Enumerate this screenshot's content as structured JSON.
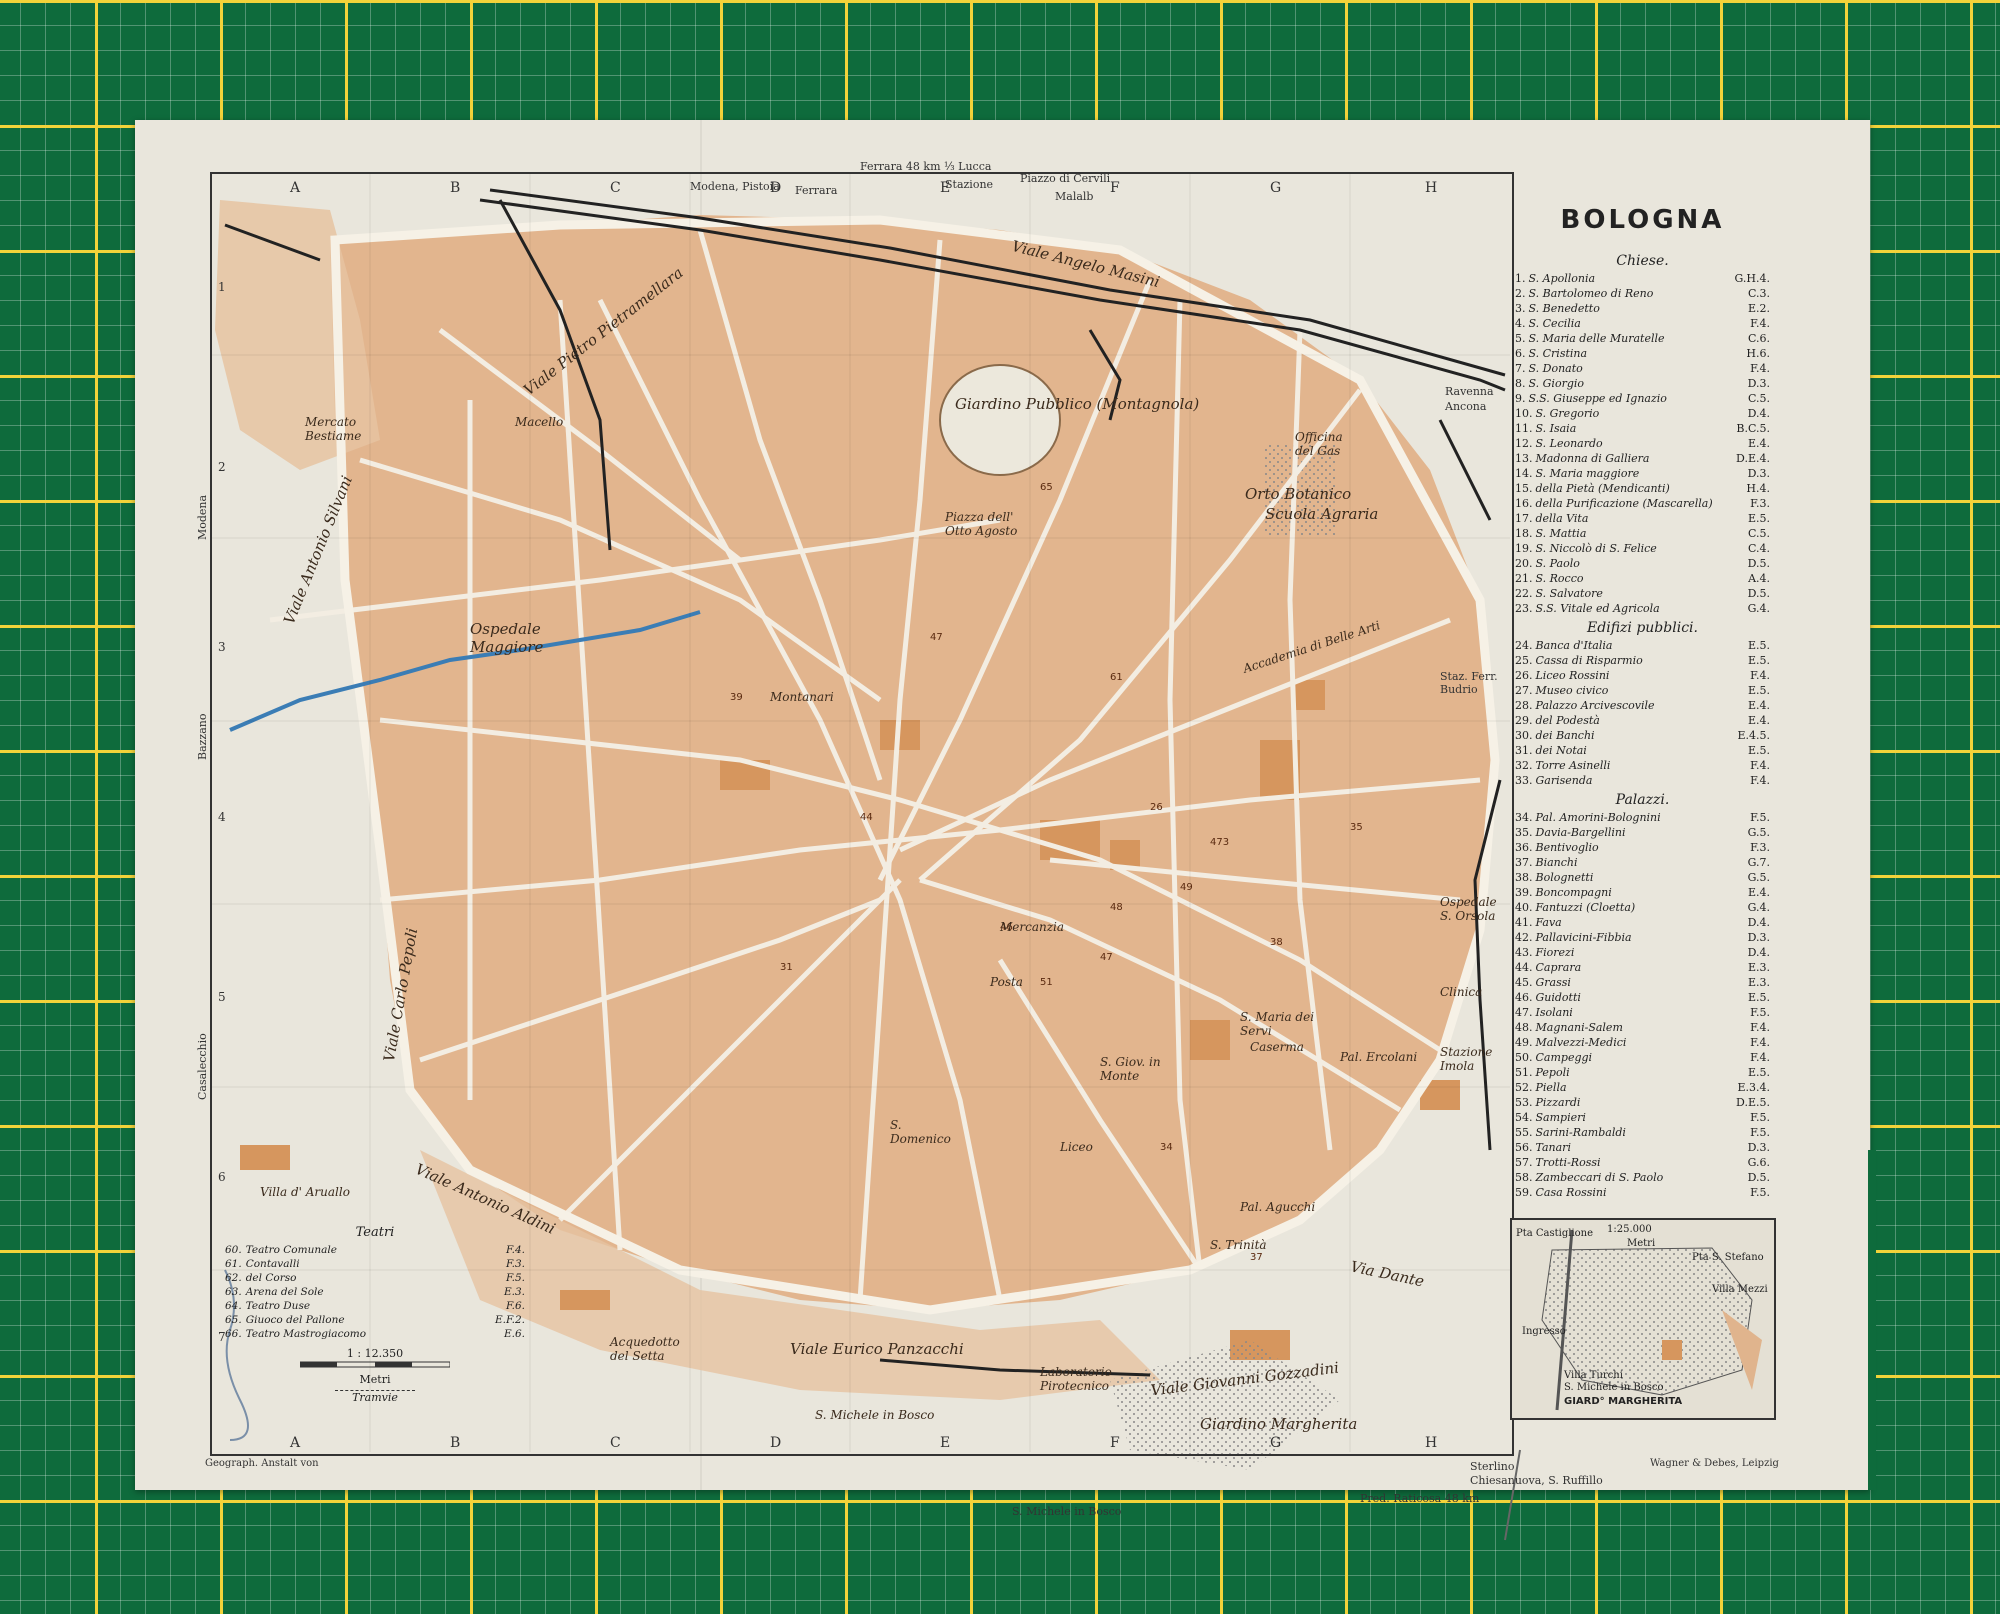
{
  "title": "BOLOGNA",
  "colors": {
    "board": "#0e6b3c",
    "grid_major": "#f2d33a",
    "paper": "#e9e6dc",
    "block": "#e0b48d",
    "block_dark": "#d6965e",
    "street": "#f3ede2",
    "river": "#3b7db5",
    "railway": "#222222"
  },
  "grid": {
    "letters": [
      "A",
      "B",
      "C",
      "D",
      "E",
      "F",
      "G",
      "H"
    ],
    "numbers": [
      "1",
      "2",
      "3",
      "4",
      "5",
      "6",
      "7"
    ]
  },
  "edge_labels": {
    "top": [
      "Ferrara 48 km ⅓ Lucca",
      "Modena, Pistoia",
      "Ferrara",
      "Stazione",
      "Piazzo di Cervili",
      "Malalb"
    ],
    "right": [
      "Ravenna",
      "Ancona",
      "Staz. Ferr. Budrio"
    ],
    "bottom": [
      "S. Michele in Bosco",
      "Sterlino",
      "Chiesanuova, S. Ruffillo",
      "Pred. Raticosa 48 km"
    ],
    "left": [
      "Modena",
      "Bazzano",
      "Casalecchio"
    ]
  },
  "map_labels": [
    {
      "text": "Giardino Pubblico (Montagnola)"
    },
    {
      "text": "Piazza dell' Otto Agosto"
    },
    {
      "text": "Orto Botanico"
    },
    {
      "text": "Scuola Agraria"
    },
    {
      "text": "Officina del Gas"
    },
    {
      "text": "Ospedale Maggiore"
    },
    {
      "text": "Macello"
    },
    {
      "text": "Mercato Bestiame"
    },
    {
      "text": "Accademia di Belle Arti"
    },
    {
      "text": "S. Maria dei Servi"
    },
    {
      "text": "Caserma"
    },
    {
      "text": "Pal. Ercolani"
    },
    {
      "text": "S. Giov. in Monte"
    },
    {
      "text": "Liceo"
    },
    {
      "text": "Pal. Agucchi"
    },
    {
      "text": "S. Trinità"
    },
    {
      "text": "S. Domenico"
    },
    {
      "text": "Posta"
    },
    {
      "text": "Mercanzia"
    },
    {
      "text": "Montanari"
    },
    {
      "text": "Villa d' Aruallo"
    },
    {
      "text": "Ospedale S. Orsola"
    },
    {
      "text": "Clinica"
    },
    {
      "text": "Stazione Imola"
    },
    {
      "text": "Viale Antonio Aldini"
    },
    {
      "text": "Viale Eurico Panzacchi"
    },
    {
      "text": "Viale Giovanni Gozzadini"
    },
    {
      "text": "Via Dante"
    },
    {
      "text": "Viale Pietro Pietramellara"
    },
    {
      "text": "Viale Antonio Silvani"
    },
    {
      "text": "Viale Carlo Pepoli"
    },
    {
      "text": "Giardino Margherita"
    },
    {
      "text": "Viale Angelo Masini"
    },
    {
      "text": "Acquedotto del Setta"
    },
    {
      "text": "Laboratorio Pirotecnico"
    },
    {
      "text": "S. Michele in Bosco"
    }
  ],
  "legend": {
    "sections": [
      {
        "heading": "Chiese.",
        "items": [
          {
            "n": "1.",
            "name": "S. Apollonia",
            "ref": "G.H.4."
          },
          {
            "n": "2.",
            "name": "S. Bartolomeo di Reno",
            "ref": "C.3."
          },
          {
            "n": "3.",
            "name": "S. Benedetto",
            "ref": "E.2."
          },
          {
            "n": "4.",
            "name": "S. Cecilia",
            "ref": "F.4."
          },
          {
            "n": "5.",
            "name": "S. Maria delle Muratelle",
            "ref": "C.6."
          },
          {
            "n": "6.",
            "name": "S. Cristina",
            "ref": "H.6."
          },
          {
            "n": "7.",
            "name": "S. Donato",
            "ref": "F.4."
          },
          {
            "n": "8.",
            "name": "S. Giorgio",
            "ref": "D.3."
          },
          {
            "n": "9.",
            "name": "S.S. Giuseppe ed Ignazio",
            "ref": "C.5."
          },
          {
            "n": "10.",
            "name": "S. Gregorio",
            "ref": "D.4."
          },
          {
            "n": "11.",
            "name": "S. Isaia",
            "ref": "B.C.5."
          },
          {
            "n": "12.",
            "name": "S. Leonardo",
            "ref": "E.4."
          },
          {
            "n": "13.",
            "name": "Madonna di Galliera",
            "ref": "D.E.4."
          },
          {
            "n": "14.",
            "name": "S. Maria maggiore",
            "ref": "D.3."
          },
          {
            "n": "15.",
            "name": "della Pietà (Mendicanti)",
            "ref": "H.4."
          },
          {
            "n": "16.",
            "name": "della Purificazione (Mascarella)",
            "ref": "F.3."
          },
          {
            "n": "17.",
            "name": "della Vita",
            "ref": "E.5."
          },
          {
            "n": "18.",
            "name": "S. Mattia",
            "ref": "C.5."
          },
          {
            "n": "19.",
            "name": "S. Niccolò di S. Felice",
            "ref": "C.4."
          },
          {
            "n": "20.",
            "name": "S. Paolo",
            "ref": "D.5."
          },
          {
            "n": "21.",
            "name": "S. Rocco",
            "ref": "A.4."
          },
          {
            "n": "22.",
            "name": "S. Salvatore",
            "ref": "D.5."
          },
          {
            "n": "23.",
            "name": "S.S. Vitale ed Agricola",
            "ref": "G.4."
          }
        ]
      },
      {
        "heading": "Edifizi pubblici.",
        "items": [
          {
            "n": "24.",
            "name": "Banca d'Italia",
            "ref": "E.5."
          },
          {
            "n": "25.",
            "name": "Cassa di Risparmio",
            "ref": "E.5."
          },
          {
            "n": "26.",
            "name": "Liceo Rossini",
            "ref": "F.4."
          },
          {
            "n": "27.",
            "name": "Museo civico",
            "ref": "E.5."
          },
          {
            "n": "28.",
            "name": "Palazzo Arcivescovile",
            "ref": "E.4."
          },
          {
            "n": "29.",
            "name": "del Podestà",
            "ref": "E.4."
          },
          {
            "n": "30.",
            "name": "dei Banchi",
            "ref": "E.4.5."
          },
          {
            "n": "31.",
            "name": "dei Notai",
            "ref": "E.5."
          },
          {
            "n": "32.",
            "name": "Torre Asinelli",
            "ref": "F.4."
          },
          {
            "n": "33.",
            "name": "Garisenda",
            "ref": "F.4."
          }
        ]
      },
      {
        "heading": "Palazzi.",
        "items": [
          {
            "n": "34.",
            "name": "Pal. Amorini-Bolognini",
            "ref": "F.5."
          },
          {
            "n": "35.",
            "name": "Davia-Bargellini",
            "ref": "G.5."
          },
          {
            "n": "36.",
            "name": "Bentivoglio",
            "ref": "F.3."
          },
          {
            "n": "37.",
            "name": "Bianchi",
            "ref": "G.7."
          },
          {
            "n": "38.",
            "name": "Bolognetti",
            "ref": "G.5."
          },
          {
            "n": "39.",
            "name": "Boncompagni",
            "ref": "E.4."
          },
          {
            "n": "40.",
            "name": "Fantuzzi (Cloetta)",
            "ref": "G.4."
          },
          {
            "n": "41.",
            "name": "Fava",
            "ref": "D.4."
          },
          {
            "n": "42.",
            "name": "Pallavicini-Fibbia",
            "ref": "D.3."
          },
          {
            "n": "43.",
            "name": "Fiorezi",
            "ref": "D.4."
          },
          {
            "n": "44.",
            "name": "Caprara",
            "ref": "E.3."
          },
          {
            "n": "45.",
            "name": "Grassi",
            "ref": "E.3."
          },
          {
            "n": "46.",
            "name": "Guidotti",
            "ref": "E.5."
          },
          {
            "n": "47.",
            "name": "Isolani",
            "ref": "F.5."
          },
          {
            "n": "48.",
            "name": "Magnani-Salem",
            "ref": "F.4."
          },
          {
            "n": "49.",
            "name": "Malvezzi-Medici",
            "ref": "F.4."
          },
          {
            "n": "50.",
            "name": "Campeggi",
            "ref": "F.4."
          },
          {
            "n": "51.",
            "name": "Pepoli",
            "ref": "E.5."
          },
          {
            "n": "52.",
            "name": "Piella",
            "ref": "E.3.4."
          },
          {
            "n": "53.",
            "name": "Pizzardi",
            "ref": "D.E.5."
          },
          {
            "n": "54.",
            "name": "Sampieri",
            "ref": "F.5."
          },
          {
            "n": "55.",
            "name": "Sarini-Rambaldi",
            "ref": "F.5."
          },
          {
            "n": "56.",
            "name": "Tanari",
            "ref": "D.3."
          },
          {
            "n": "57.",
            "name": "Trotti-Rossi",
            "ref": "G.6."
          },
          {
            "n": "58.",
            "name": "Zambeccari di S. Paolo",
            "ref": "D.5."
          },
          {
            "n": "59.",
            "name": "Casa Rossini",
            "ref": "F.5."
          }
        ]
      }
    ]
  },
  "teatri": {
    "heading": "Teatri",
    "items": [
      {
        "n": "60.",
        "name": "Teatro Comunale",
        "ref": "F.4."
      },
      {
        "n": "61.",
        "name": "Contavalli",
        "ref": "F.3."
      },
      {
        "n": "62.",
        "name": "del Corso",
        "ref": "F.5."
      },
      {
        "n": "63.",
        "name": "Arena del Sole",
        "ref": "E.3."
      },
      {
        "n": "64.",
        "name": "Teatro Duse",
        "ref": "F.6."
      },
      {
        "n": "65.",
        "name": "Giuoco del Pallone",
        "ref": "E.F.2."
      },
      {
        "n": "66.",
        "name": "Teatro Mastrogiacomo",
        "ref": "E.6."
      }
    ],
    "scale": "1 : 12.350",
    "scale_unit": "Metri",
    "tramway": "Tramvie"
  },
  "inset": {
    "title": "GIARD° MARGHERITA",
    "scale": "1:25.000",
    "unit": "Metri",
    "labels": [
      "Pta Castiglione",
      "Pta S. Stefano",
      "Villa Mezzi",
      "Ingresso",
      "Villa Turchi",
      "S. Michele in Bosco"
    ]
  },
  "credits": {
    "left": "Geograph. Anstalt von",
    "right": "Wagner & Debes, Leipzig"
  }
}
